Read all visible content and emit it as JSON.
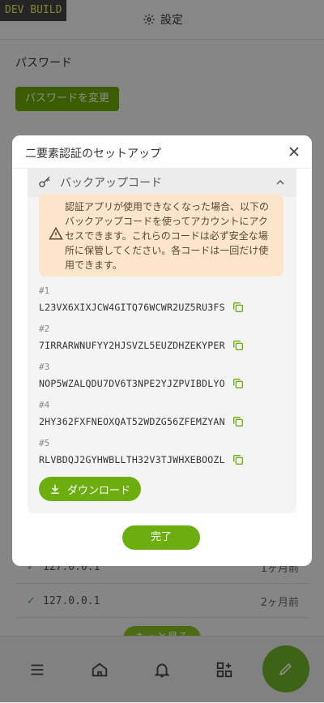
{
  "dev_badge": "DEV BUILD",
  "header": {
    "title": "設定"
  },
  "password_section": {
    "title": "パスワード",
    "change_button": "パスワードを変更"
  },
  "sessions": [
    {
      "ip": "127.0.0.1",
      "time": "1ヶ月前"
    },
    {
      "ip": "127.0.0.1",
      "time": "2ヶ月前"
    }
  ],
  "more_button": "もっと見る",
  "modal": {
    "title": "二要素認証のセットアップ",
    "backup": {
      "header": "バックアップコード",
      "warning_lines": [
        "認証アプリが使用できなくなった場合、以下の",
        "バックアップコードを使ってアカウントにアク",
        "セスできます。これらのコードは必ず安全な場",
        "所に保管してください。各コードは一回だけ使",
        "用できます。"
      ],
      "codes": [
        {
          "num": "#1",
          "code": "L23VX6XIXJCW4GITQ76WCWR2UZ5RU3FS"
        },
        {
          "num": "#2",
          "code": "7IRRARWNUFYY2HJSVZL5EUZDHZEKYPER"
        },
        {
          "num": "#3",
          "code": "NOP5WZALQDU7DV6T3NPE2YJZPVIBDLYO"
        },
        {
          "num": "#4",
          "code": "2HY362FXFNEOXQAT52WDZG56ZFEMZYAN"
        },
        {
          "num": "#5",
          "code": "RLVBDQJ2GYHWBLLTH32V3TJWHXEBOOZL"
        }
      ],
      "download_label": "ダウンロード"
    },
    "done_label": "完了"
  },
  "colors": {
    "accent": "#6cae10",
    "warning_bg": "#fde5cc"
  },
  "icons": [
    "gear-icon",
    "close-icon",
    "key-icon",
    "chevron-up-icon",
    "warning-icon",
    "copy-icon",
    "download-icon",
    "menu-icon",
    "home-icon",
    "bell-icon",
    "apps-icon",
    "edit-icon"
  ]
}
